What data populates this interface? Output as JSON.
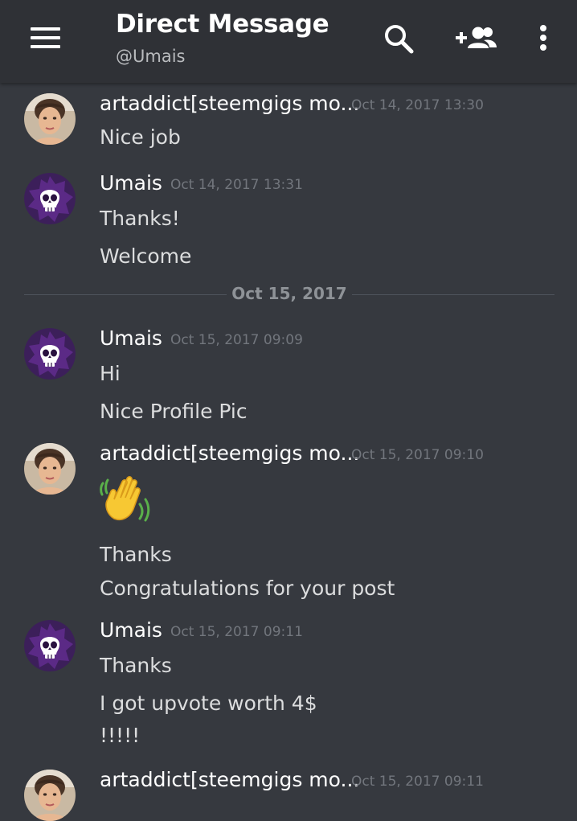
{
  "header": {
    "title": "Direct Message",
    "subtitle": "@Umais",
    "icons": [
      "menu-icon",
      "search-icon",
      "add-friend-icon",
      "more-vertical-icon"
    ]
  },
  "users": {
    "artaddict": {
      "name": "artaddict[steemgigs mo...",
      "avatar": "photo"
    },
    "umais": {
      "name": "Umais",
      "avatar": "purple-skull",
      "avatar_color": "#5b2a86"
    }
  },
  "messages": [
    {
      "author": "artaddict[steemgigs mo...",
      "time": "Oct 14, 2017 13:30",
      "lines": [
        "Nice job"
      ]
    },
    {
      "author": "Umais",
      "time": "Oct 14, 2017 13:31",
      "lines": [
        "Thanks!",
        "Welcome"
      ]
    },
    {
      "author": "Umais",
      "time": "Oct 15, 2017 09:09",
      "lines": [
        "Hi",
        "Nice Profile Pic"
      ]
    },
    {
      "author": "artaddict[steemgigs mo...",
      "time": "Oct 15, 2017 09:10",
      "emoji": "waving-hand",
      "lines": [
        "Thanks",
        "Congratulations for your post"
      ]
    },
    {
      "author": "Umais",
      "time": "Oct 15, 2017 09:11",
      "lines": [
        "Thanks",
        "I got upvote worth 4$",
        "!!!!!"
      ]
    },
    {
      "author": "artaddict[steemgigs mo...",
      "time": "Oct 15, 2017 09:11",
      "lines": []
    }
  ],
  "date_divider": "Oct 15, 2017",
  "colors": {
    "background": "#36393f",
    "header": "#2f3136",
    "timestamp": "#72767d",
    "divider": "#4f545c"
  }
}
